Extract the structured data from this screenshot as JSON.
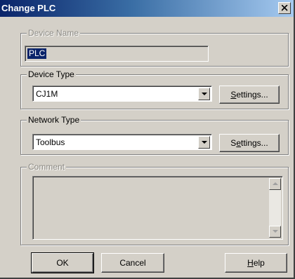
{
  "window": {
    "title": "Change PLC",
    "close_glyph": "X"
  },
  "device_name": {
    "legend": "Device Name",
    "value": "PLC"
  },
  "device_type": {
    "legend": "Device Type",
    "value": "CJ1M",
    "settings_pre": "",
    "settings_key": "S",
    "settings_post": "ettings..."
  },
  "network_type": {
    "legend": "Network Type",
    "value": "Toolbus",
    "settings_pre": "S",
    "settings_key": "e",
    "settings_post": "ttings..."
  },
  "comment": {
    "legend": "Comment",
    "value": ""
  },
  "buttons": {
    "ok": "OK",
    "cancel": "Cancel",
    "help_key": "H",
    "help_post": "elp"
  },
  "colors": {
    "title_bar": "#0a246a",
    "face": "#d4d0c8",
    "selection": "#0a246a"
  },
  "icons": {
    "dropdown": "chevron-down-icon",
    "close": "close-icon",
    "scroll_up": "arrow-up-icon",
    "scroll_down": "arrow-down-icon"
  }
}
